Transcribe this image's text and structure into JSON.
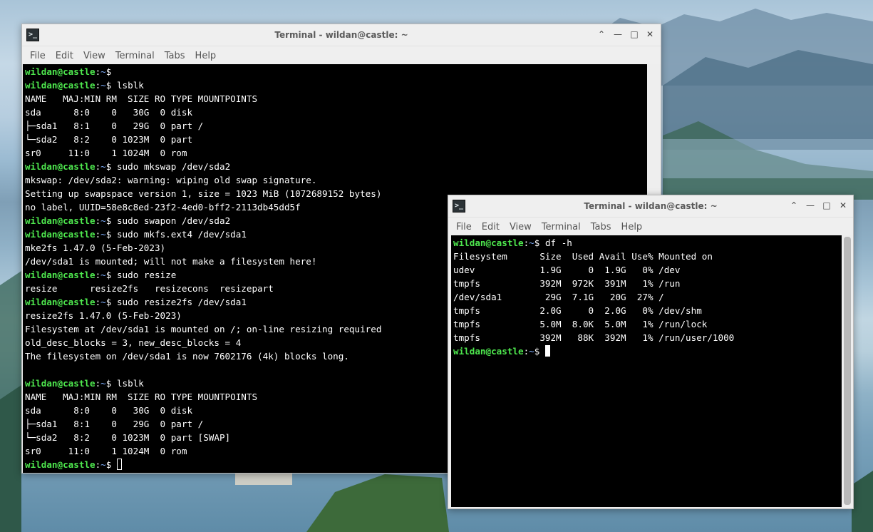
{
  "windows": {
    "left": {
      "title": "Terminal - wildan@castle: ~",
      "menu": [
        "File",
        "Edit",
        "View",
        "Terminal",
        "Tabs",
        "Help"
      ],
      "lines": [
        {
          "user": "wildan@castle",
          "path": "~",
          "sym": "$",
          "cmd": ""
        },
        {
          "user": "wildan@castle",
          "path": "~",
          "sym": "$",
          "cmd": " lsblk"
        },
        {
          "text": "NAME   MAJ:MIN RM  SIZE RO TYPE MOUNTPOINTS"
        },
        {
          "text": "sda      8:0    0   30G  0 disk "
        },
        {
          "text": "├─sda1   8:1    0   29G  0 part /"
        },
        {
          "text": "└─sda2   8:2    0 1023M  0 part "
        },
        {
          "text": "sr0     11:0    1 1024M  0 rom  "
        },
        {
          "user": "wildan@castle",
          "path": "~",
          "sym": "$",
          "cmd": " sudo mkswap /dev/sda2"
        },
        {
          "text": "mkswap: /dev/sda2: warning: wiping old swap signature."
        },
        {
          "text": "Setting up swapspace version 1, size = 1023 MiB (1072689152 bytes)"
        },
        {
          "text": "no label, UUID=58e8c8ed-23f2-4ed0-bff2-2113db45dd5f"
        },
        {
          "user": "wildan@castle",
          "path": "~",
          "sym": "$",
          "cmd": " sudo swapon /dev/sda2"
        },
        {
          "user": "wildan@castle",
          "path": "~",
          "sym": "$",
          "cmd": " sudo mkfs.ext4 /dev/sda1"
        },
        {
          "text": "mke2fs 1.47.0 (5-Feb-2023)"
        },
        {
          "text": "/dev/sda1 is mounted; will not make a filesystem here!"
        },
        {
          "user": "wildan@castle",
          "path": "~",
          "sym": "$",
          "cmd": " sudo resize"
        },
        {
          "text": "resize      resize2fs   resizecons  resizepart"
        },
        {
          "user": "wildan@castle",
          "path": "~",
          "sym": "$",
          "cmd": " sudo resize2fs /dev/sda1"
        },
        {
          "text": "resize2fs 1.47.0 (5-Feb-2023)"
        },
        {
          "text": "Filesystem at /dev/sda1 is mounted on /; on-line resizing required"
        },
        {
          "text": "old_desc_blocks = 3, new_desc_blocks = 4"
        },
        {
          "text": "The filesystem on /dev/sda1 is now 7602176 (4k) blocks long."
        },
        {
          "text": ""
        },
        {
          "user": "wildan@castle",
          "path": "~",
          "sym": "$",
          "cmd": " lsblk"
        },
        {
          "text": "NAME   MAJ:MIN RM  SIZE RO TYPE MOUNTPOINTS"
        },
        {
          "text": "sda      8:0    0   30G  0 disk "
        },
        {
          "text": "├─sda1   8:1    0   29G  0 part /"
        },
        {
          "text": "└─sda2   8:2    0 1023M  0 part [SWAP]"
        },
        {
          "text": "sr0     11:0    1 1024M  0 rom  "
        },
        {
          "user": "wildan@castle",
          "path": "~",
          "sym": "$",
          "cmd": " ",
          "cursor": "hollow"
        }
      ]
    },
    "right": {
      "title": "Terminal - wildan@castle: ~",
      "menu": [
        "File",
        "Edit",
        "View",
        "Terminal",
        "Tabs",
        "Help"
      ],
      "lines": [
        {
          "user": "wildan@castle",
          "path": "~",
          "sym": "$",
          "cmd": " df -h"
        },
        {
          "text": "Filesystem      Size  Used Avail Use% Mounted on"
        },
        {
          "text": "udev            1.9G     0  1.9G   0% /dev"
        },
        {
          "text": "tmpfs           392M  972K  391M   1% /run"
        },
        {
          "text": "/dev/sda1        29G  7.1G   20G  27% /"
        },
        {
          "text": "tmpfs           2.0G     0  2.0G   0% /dev/shm"
        },
        {
          "text": "tmpfs           5.0M  8.0K  5.0M   1% /run/lock"
        },
        {
          "text": "tmpfs           392M   88K  392M   1% /run/user/1000"
        },
        {
          "user": "wildan@castle",
          "path": "~",
          "sym": "$",
          "cmd": " ",
          "cursor": "solid"
        }
      ]
    }
  },
  "colors": {
    "prompt_user": "#4ee84e",
    "prompt_path": "#7fb0ff",
    "terminal_bg": "#000000",
    "terminal_fg": "#ffffff"
  },
  "icons": {
    "app": "terminal-icon",
    "maximize_restore": "chevron-up-icon",
    "minimize": "minimize-icon",
    "maximize": "maximize-icon",
    "close": "close-icon"
  }
}
